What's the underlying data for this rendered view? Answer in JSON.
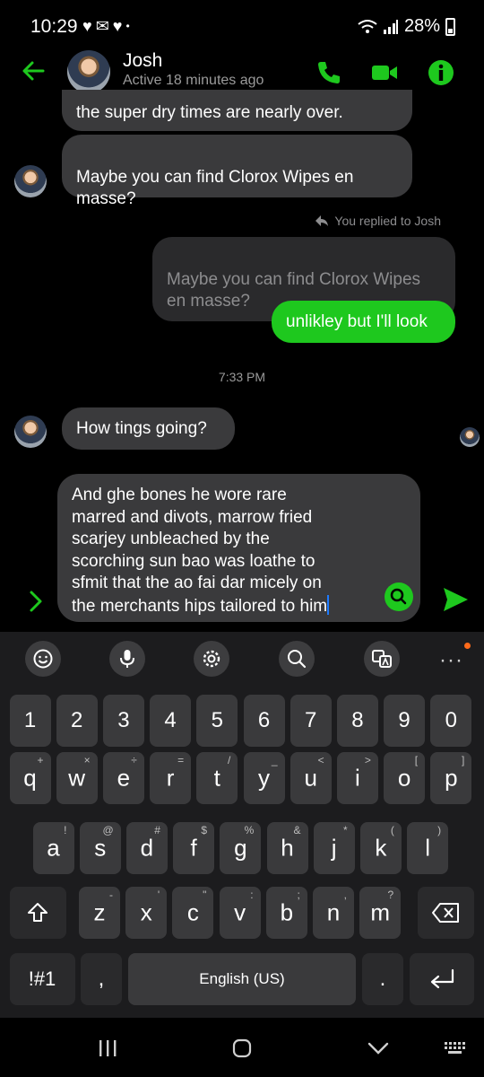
{
  "status_bar": {
    "time": "10:29",
    "battery": "28%"
  },
  "header": {
    "contact_name": "Josh",
    "contact_status": "Active 18 minutes ago"
  },
  "messages": {
    "partial_top": "the super dry times are nearly over.",
    "josh_msg_1": "Maybe you can find Clorox Wipes en\nmasse?",
    "reply_note": "You replied to Josh",
    "quoted_reply": "Maybe you can find Clorox Wipes\nen masse?",
    "my_reply": "unlikley but I'll look",
    "timestamp": "7:33 PM",
    "josh_msg_2": "How tings going?"
  },
  "composer": {
    "text": "And ghe bones he wore rare\nmarred and divots, marrow fried\nscarjey unbleached by the\nscorching sun bao was loathe to\nsfmit that the ao fai dar micely on\nthe merchants hips tailored to him"
  },
  "keyboard": {
    "numbers": [
      "1",
      "2",
      "3",
      "4",
      "5",
      "6",
      "7",
      "8",
      "9",
      "0"
    ],
    "row1": [
      {
        "k": "q",
        "h": "+"
      },
      {
        "k": "w",
        "h": "×"
      },
      {
        "k": "e",
        "h": "÷"
      },
      {
        "k": "r",
        "h": "="
      },
      {
        "k": "t",
        "h": "/"
      },
      {
        "k": "y",
        "h": "_"
      },
      {
        "k": "u",
        "h": "<"
      },
      {
        "k": "i",
        "h": ">"
      },
      {
        "k": "o",
        "h": "["
      },
      {
        "k": "p",
        "h": "]"
      }
    ],
    "row2": [
      {
        "k": "a",
        "h": "!"
      },
      {
        "k": "s",
        "h": "@"
      },
      {
        "k": "d",
        "h": "#"
      },
      {
        "k": "f",
        "h": "$"
      },
      {
        "k": "g",
        "h": "%"
      },
      {
        "k": "h",
        "h": "&"
      },
      {
        "k": "j",
        "h": "*"
      },
      {
        "k": "k",
        "h": "("
      },
      {
        "k": "l",
        "h": ")"
      }
    ],
    "row3": [
      {
        "k": "z",
        "h": "-"
      },
      {
        "k": "x",
        "h": "'"
      },
      {
        "k": "c",
        "h": "\""
      },
      {
        "k": "v",
        "h": ":"
      },
      {
        "k": "b",
        "h": ";"
      },
      {
        "k": "n",
        "h": ","
      },
      {
        "k": "m",
        "h": "?"
      }
    ],
    "symbols_key": "!#1",
    "comma_key": ",",
    "space_label": "English (US)",
    "period_key": "."
  },
  "colors": {
    "accent": "#1ec81e",
    "bubble_in": "#3a3a3c",
    "keyboard_bg": "#1c1c1e"
  },
  "icons": [
    "back-arrow",
    "phone",
    "video-camera",
    "info",
    "reply-arrow",
    "chevron-right",
    "send",
    "search",
    "emoji",
    "microphone",
    "settings",
    "translate",
    "shift",
    "backspace",
    "enter",
    "recents",
    "home",
    "back",
    "keyboard-switch"
  ]
}
